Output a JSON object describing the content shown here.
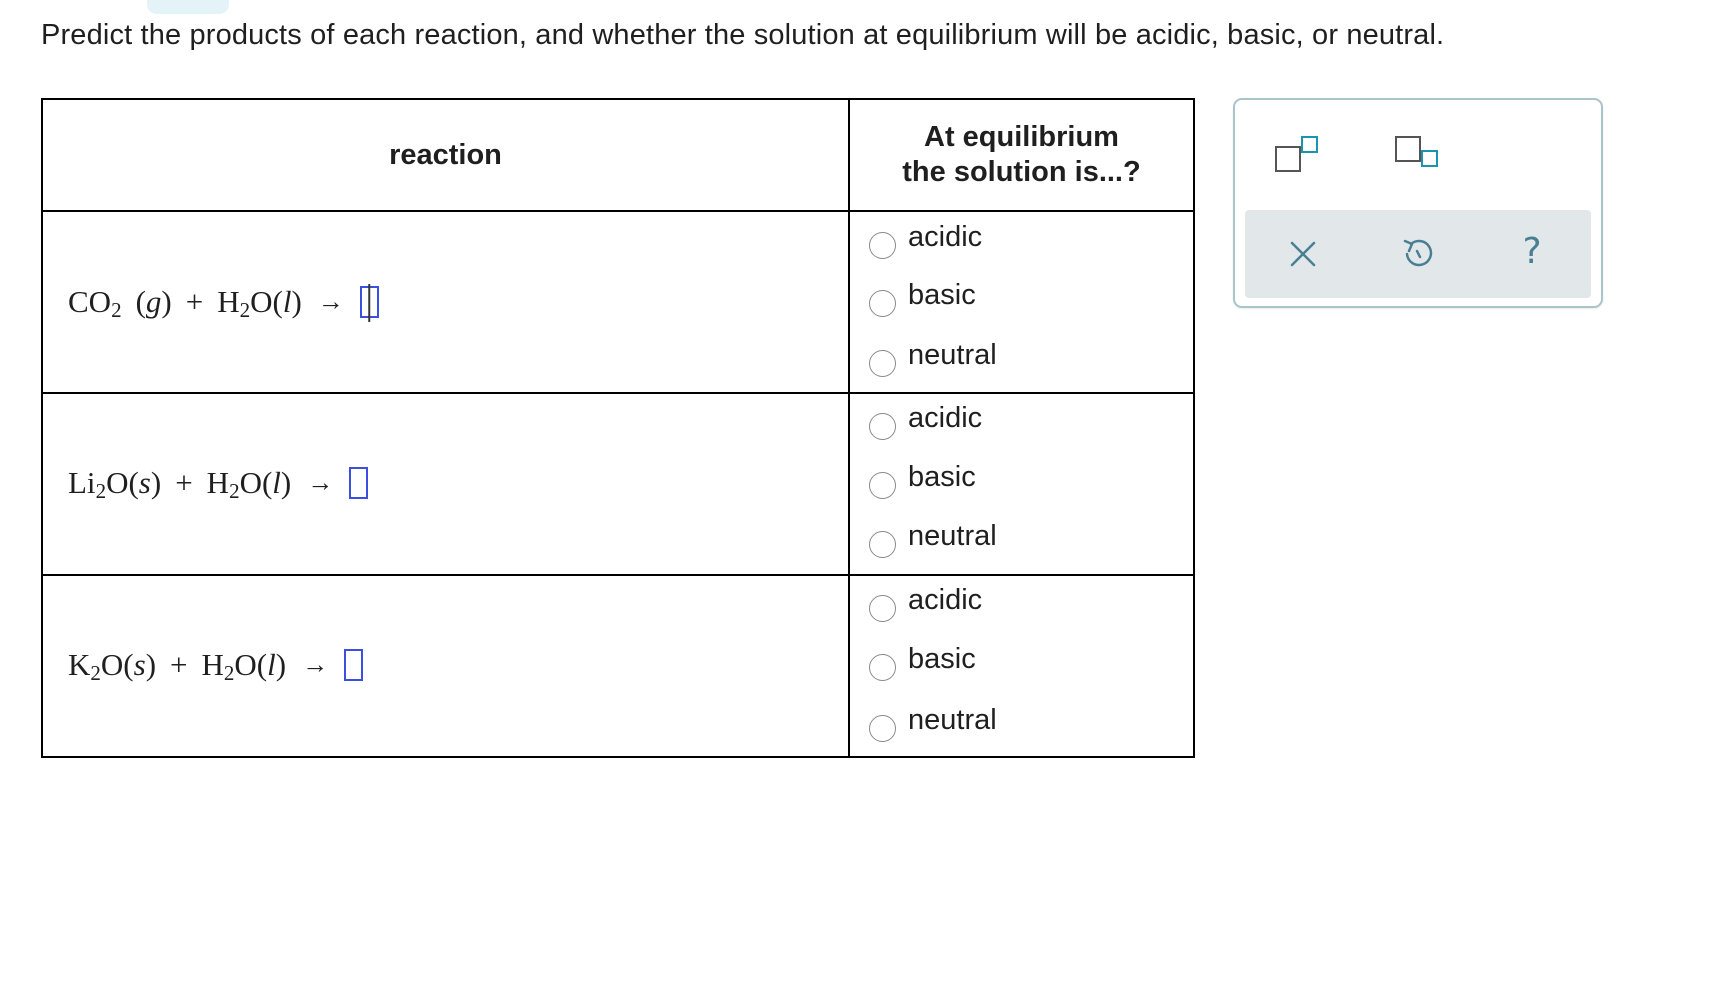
{
  "prompt": "Predict the products of each reaction, and whether the solution at equilibrium will be acidic, basic, or neutral.",
  "table": {
    "headers": {
      "reaction": "reaction",
      "equilibrium_line1": "At equilibrium",
      "equilibrium_line2": "the solution is...?"
    },
    "rows": [
      {
        "reactant1": "CO",
        "reactant1_sub": "2",
        "reactant1_state": "g",
        "plus": "+",
        "reactant2": "H",
        "reactant2_sub": "2",
        "reactant2_rest": "O",
        "reactant2_state": "l",
        "arrow": "→",
        "options": [
          "acidic",
          "basic",
          "neutral"
        ]
      },
      {
        "reactant1": "Li",
        "reactant1_sub": "2",
        "reactant1_rest": "O",
        "reactant1_state": "s",
        "plus": "+",
        "reactant2": "H",
        "reactant2_sub": "2",
        "reactant2_rest": "O",
        "reactant2_state": "l",
        "arrow": "→",
        "options": [
          "acidic",
          "basic",
          "neutral"
        ]
      },
      {
        "reactant1": "K",
        "reactant1_sub": "2",
        "reactant1_rest": "O",
        "reactant1_state": "s",
        "plus": "+",
        "reactant2": "H",
        "reactant2_sub": "2",
        "reactant2_rest": "O",
        "reactant2_state": "l",
        "arrow": "→",
        "options": [
          "acidic",
          "basic",
          "neutral"
        ]
      }
    ]
  },
  "toolbar": {
    "icons": [
      "superscript-icon",
      "subscript-icon",
      "clear-icon",
      "undo-icon",
      "help-icon"
    ],
    "help_label": "?"
  },
  "colors": {
    "answer_box_border": "#3b4fe0",
    "tool_accent": "#1b94b0",
    "tool_bar_bg": "#e2e8ea"
  }
}
